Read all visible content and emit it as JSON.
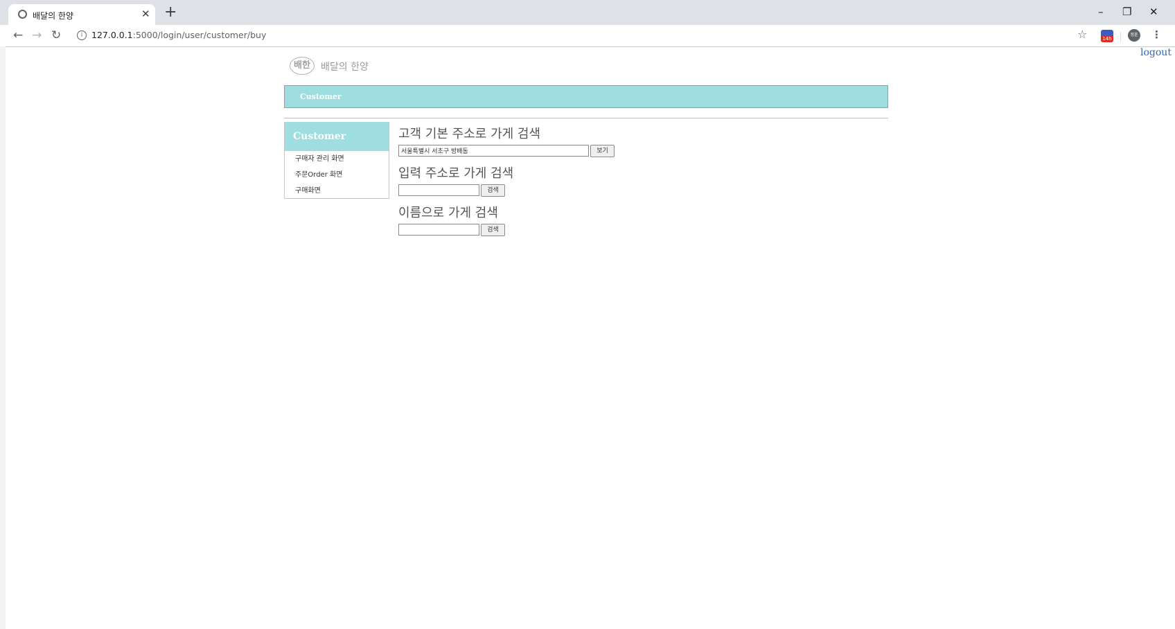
{
  "browser": {
    "tab_title": "배달의 한양",
    "tab_close": "✕",
    "new_tab": "+",
    "url_host": "127.0.0.1",
    "url_path": ":5000/login/user/customer/buy",
    "extension_badge": "14h",
    "profile_initials": "정훈",
    "window_controls": {
      "minimize": "–",
      "restore": "❐",
      "close": "✕"
    },
    "nav": {
      "back": "←",
      "forward": "→",
      "reload": "↻",
      "info": "i",
      "star": "☆",
      "menu": "⋮"
    }
  },
  "page": {
    "logout_label": "logout",
    "logo": {
      "mark": "배한",
      "name": "배달의 한양"
    },
    "banner_label": "Customer",
    "sidebar": {
      "title": "Customer",
      "items": [
        {
          "label": "구매자 관리 화면"
        },
        {
          "label": "주문Order 화면"
        },
        {
          "label": "구매화면"
        }
      ]
    },
    "search_default": {
      "title": "고객 기본 주소로 가게 검색",
      "value": "서울특별시 서초구 방배동",
      "button": "보기"
    },
    "search_input_address": {
      "title": "입력 주소로 가게 검색",
      "value": "",
      "button": "검색"
    },
    "search_name": {
      "title": "이름으로 가게 검색",
      "value": "",
      "button": "검색"
    }
  }
}
